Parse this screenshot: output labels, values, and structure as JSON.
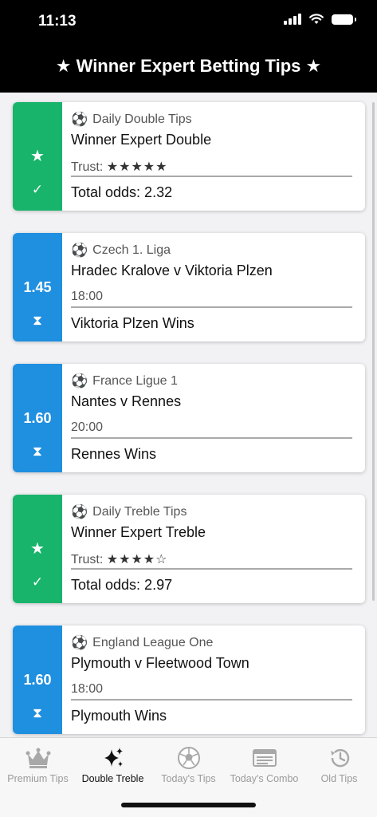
{
  "status_bar": {
    "time": "11:13"
  },
  "header": {
    "title": "★ Winner Expert Betting Tips ★"
  },
  "cards": [
    {
      "type": "combo",
      "color": "#18b46b",
      "side_top": "★",
      "side_icon": "✓",
      "league": "Daily Double Tips",
      "match": "Winner Expert Double",
      "trust_label": "Trust:",
      "trust_stars": "★★★★★",
      "result": "Total odds: 2.32"
    },
    {
      "type": "tip",
      "color": "#1f8fe0",
      "side_top": "1.45",
      "side_icon": "⧗",
      "league": "Czech 1. Liga",
      "match": "Hradec Kralove v Viktoria Plzen",
      "time": "18:00",
      "result": "Viktoria Plzen Wins"
    },
    {
      "type": "tip",
      "color": "#1f8fe0",
      "side_top": "1.60",
      "side_icon": "⧗",
      "league": "France Ligue 1",
      "match": "Nantes v Rennes",
      "time": "20:00",
      "result": "Rennes Wins"
    },
    {
      "type": "combo",
      "color": "#18b46b",
      "side_top": "★",
      "side_icon": "✓",
      "league": "Daily Treble Tips",
      "match": "Winner Expert Treble",
      "trust_label": "Trust:",
      "trust_stars": "★★★★☆",
      "result": "Total odds: 2.97"
    },
    {
      "type": "tip",
      "color": "#1f8fe0",
      "side_top": "1.60",
      "side_icon": "⧗",
      "league": "England League One",
      "match": "Plymouth v Fleetwood Town",
      "time": "18:00",
      "result": "Plymouth Wins"
    }
  ],
  "tabbar": {
    "active_index": 1,
    "tabs": [
      {
        "label": "Premium Tips",
        "icon": "crown-icon"
      },
      {
        "label": "Double Treble",
        "icon": "sparkles-icon"
      },
      {
        "label": "Today's Tips",
        "icon": "soccer-ball-icon"
      },
      {
        "label": "Today's Combo",
        "icon": "ticket-icon"
      },
      {
        "label": "Old Tips",
        "icon": "history-clock-icon"
      }
    ]
  }
}
